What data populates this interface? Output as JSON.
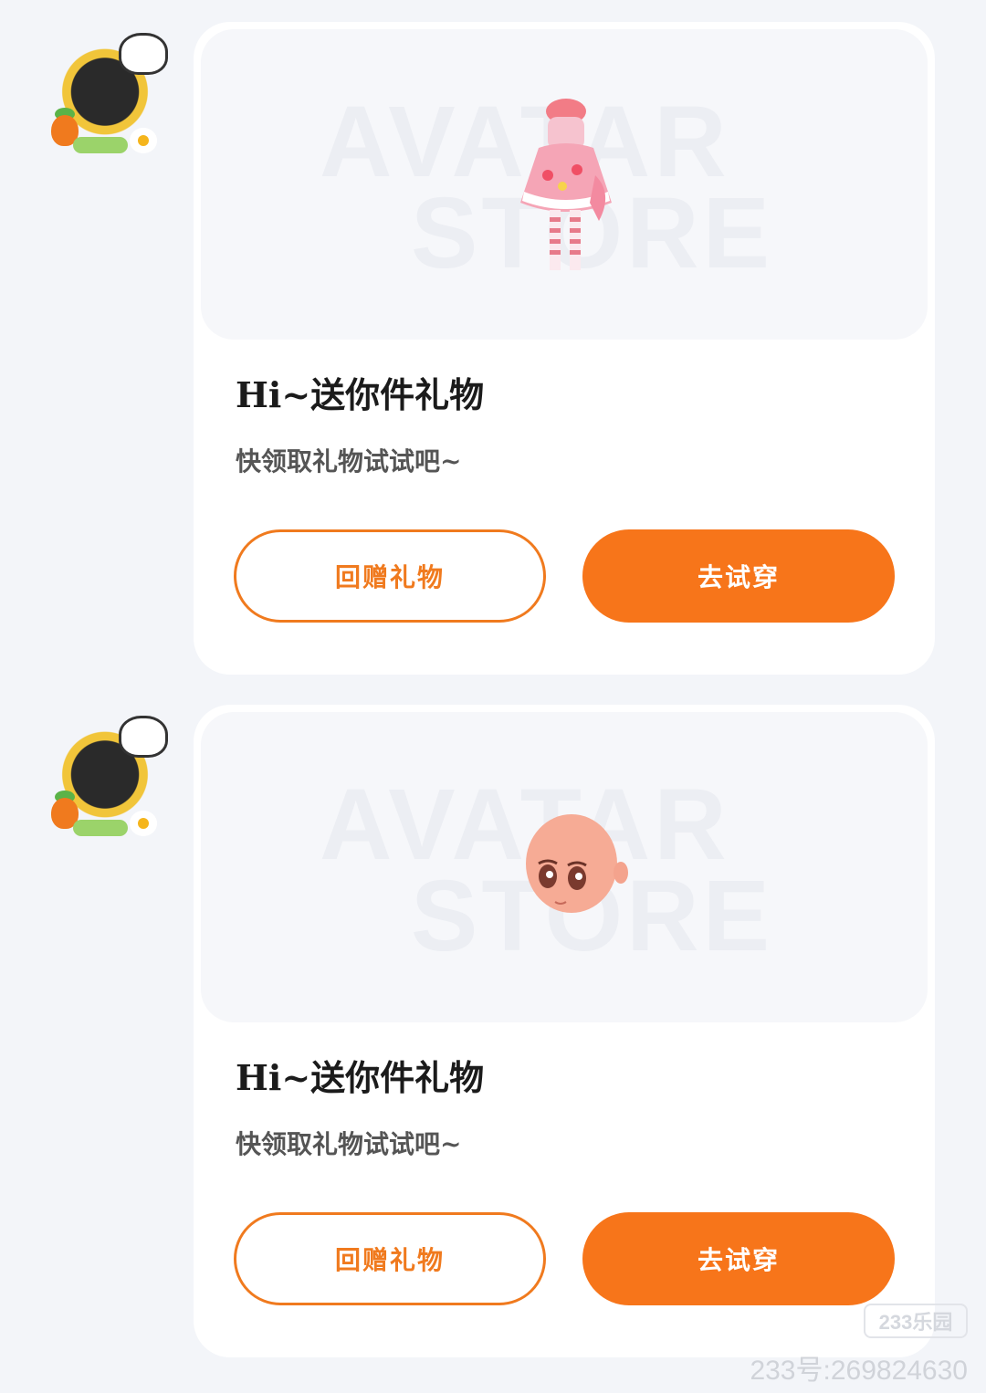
{
  "messages": [
    {
      "card": {
        "preview_watermark": [
          "AVATAR",
          "STORE"
        ],
        "preview_item": "dress-icon",
        "title": "Hi~送你件礼物",
        "subtitle": "快领取礼物试试吧~",
        "return_gift_label": "回赠礼物",
        "try_on_label": "去试穿"
      }
    },
    {
      "card": {
        "preview_watermark": [
          "AVATAR",
          "STORE"
        ],
        "preview_item": "head-icon",
        "title": "Hi~送你件礼物",
        "subtitle": "快领取礼物试试吧~",
        "return_gift_label": "回赠礼物",
        "try_on_label": "去试穿"
      }
    }
  ],
  "colors": {
    "accent": "#f7751a",
    "background": "#f3f5f9",
    "card": "#ffffff"
  },
  "watermark": {
    "site": "233乐园",
    "id_text": "233号:269824630"
  }
}
